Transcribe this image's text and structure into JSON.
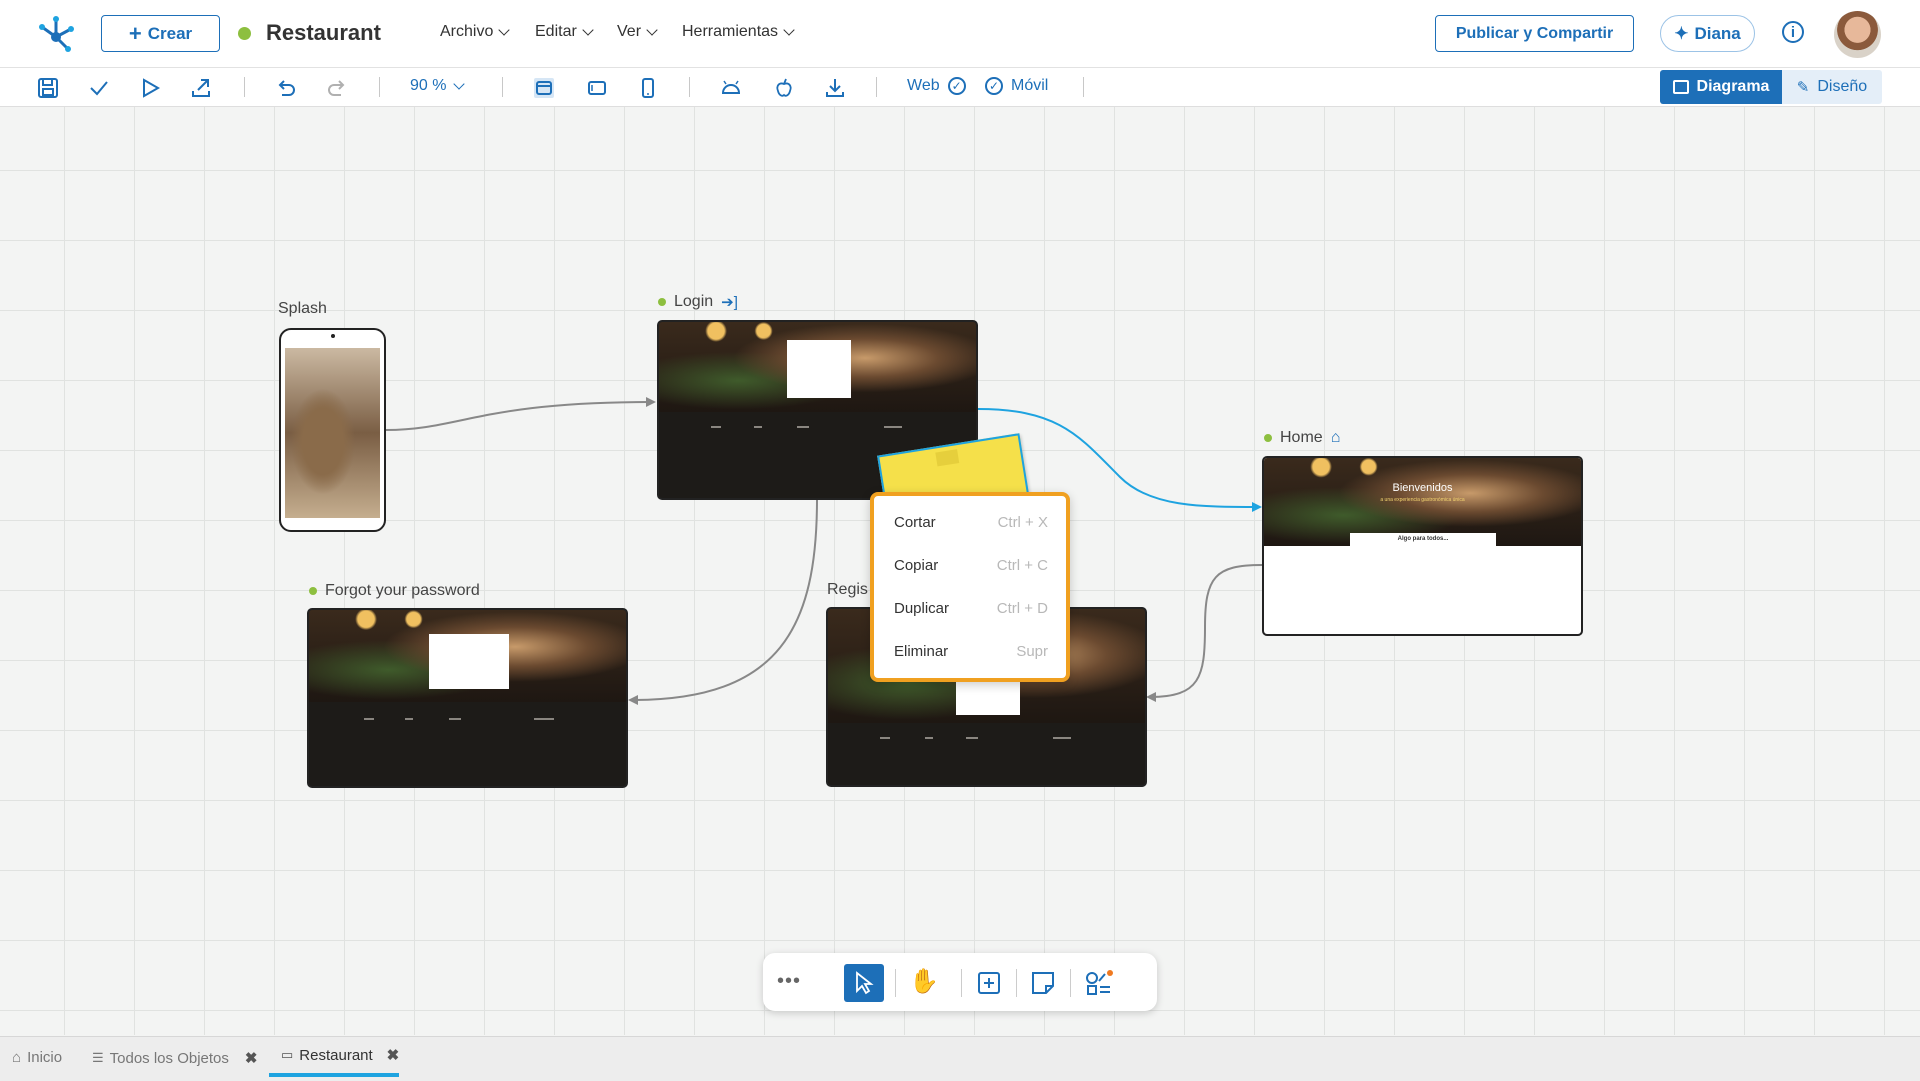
{
  "app": {
    "name": "Restaurant",
    "status_color": "#8dbf3f"
  },
  "topbar": {
    "create_label": "Crear",
    "menus": [
      "Archivo",
      "Editar",
      "Ver",
      "Herramientas"
    ],
    "publish_label": "Publicar y Compartir",
    "assistant_label": "Diana"
  },
  "toolbar": {
    "zoom": "90 %",
    "web_label": "Web",
    "mobile_label": "Móvil",
    "diagram_label": "Diagrama",
    "design_label": "Diseño"
  },
  "nodes": {
    "splash": "Splash",
    "login": "Login",
    "home": "Home",
    "forgot": "Forgot your password",
    "register": "Regis"
  },
  "home_preview": {
    "heading": "Bienvenidos",
    "subheading": "a una experiencia gastronómica única",
    "card_title": "Algo para todos..."
  },
  "context_menu": [
    {
      "label": "Cortar",
      "shortcut": "Ctrl + X"
    },
    {
      "label": "Copiar",
      "shortcut": "Ctrl + C"
    },
    {
      "label": "Duplicar",
      "shortcut": "Ctrl + D"
    },
    {
      "label": "Eliminar",
      "shortcut": "Supr"
    }
  ],
  "tabs": [
    {
      "label": "Inicio",
      "closable": false
    },
    {
      "label": "Todos los Objetos",
      "closable": true
    },
    {
      "label": "Restaurant",
      "closable": true,
      "active": true
    }
  ],
  "colors": {
    "accent": "#1d6fb8",
    "highlight": "#f0a020",
    "link_blue": "#1ea3e0"
  }
}
